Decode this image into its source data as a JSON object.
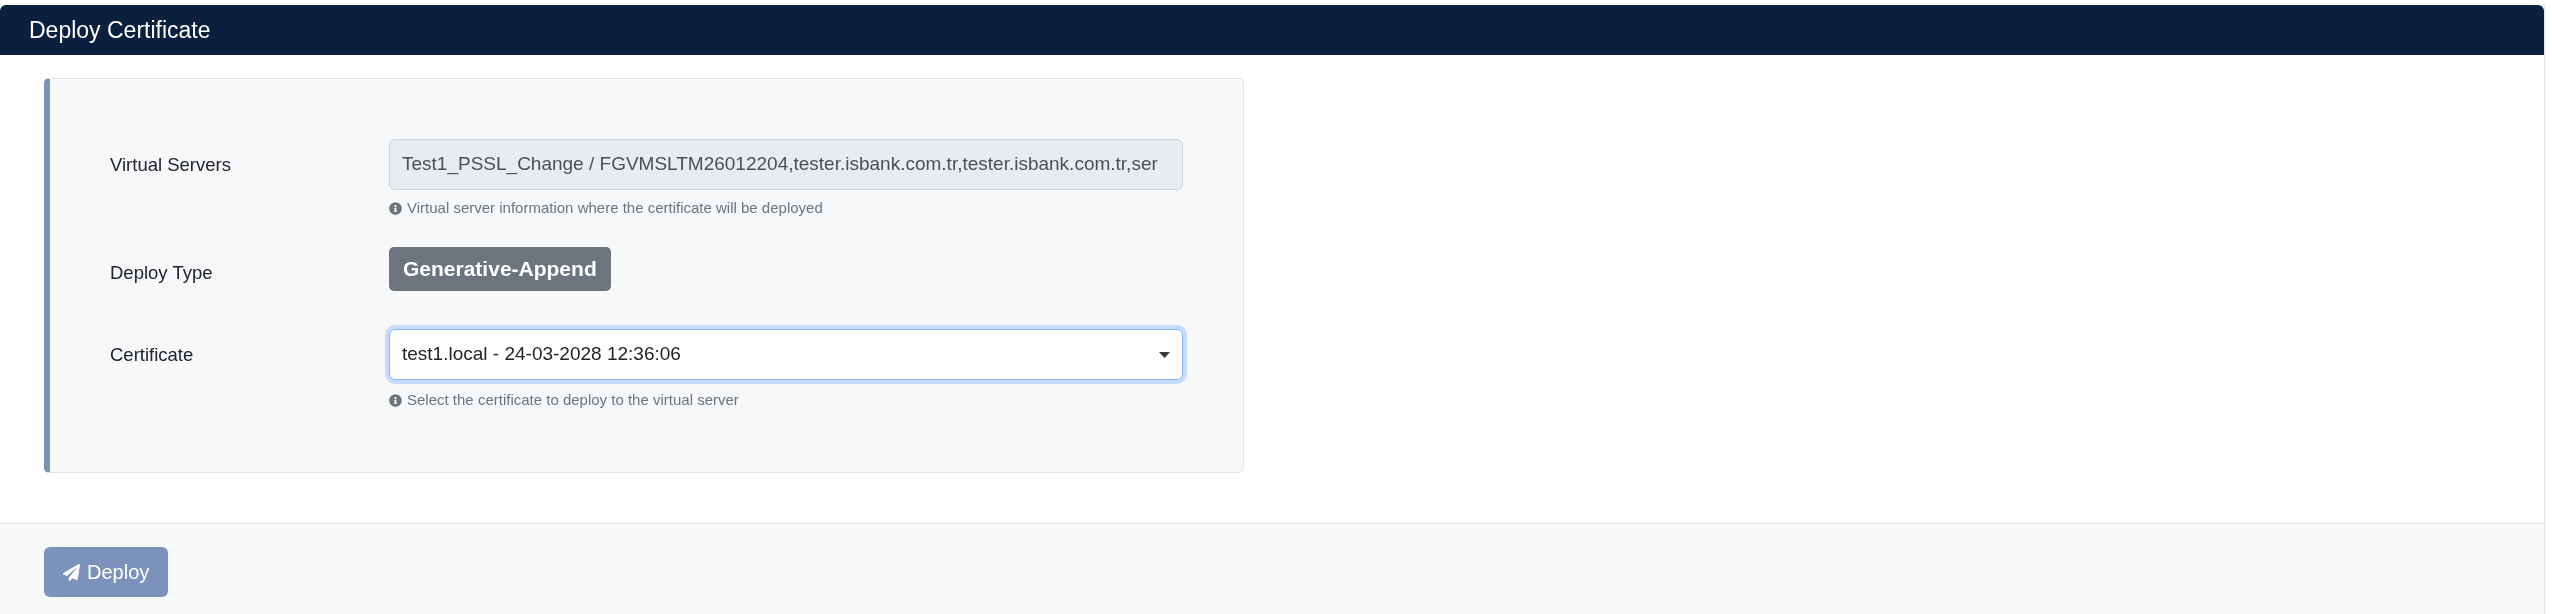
{
  "modal": {
    "title": "Deploy Certificate"
  },
  "form": {
    "fields": [
      {
        "kind": "readonly",
        "label": "Virtual Servers",
        "value": "Test1_PSSL_Change / FGVMSLTM26012204,tester.isbank.com.tr,tester.isbank.com.tr,ser",
        "help": "Virtual server information where the certificate will be deployed"
      },
      {
        "kind": "badge",
        "label": "Deploy Type",
        "value": "Generative-Append"
      },
      {
        "kind": "select",
        "label": "Certificate",
        "value": "test1.local - 24-03-2028 12:36:06",
        "focused": true,
        "help": "Select the certificate to deploy to the virtual server"
      }
    ]
  },
  "footer": {
    "buttons": [
      {
        "label": "Deploy",
        "disabled": true
      }
    ]
  }
}
